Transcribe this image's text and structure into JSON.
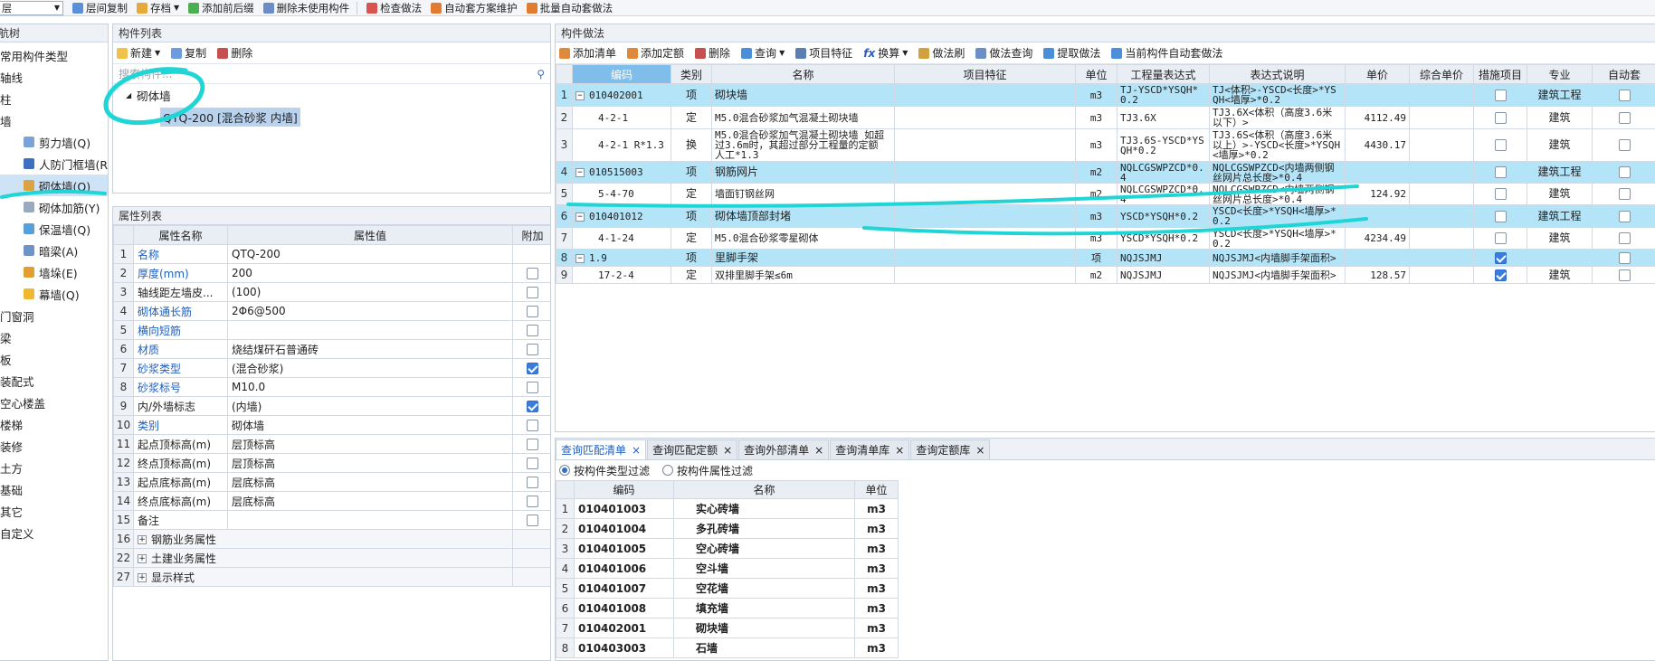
{
  "toolbar": {
    "floor_select": "层",
    "items": [
      "层间复制",
      "存档",
      "添加前后缀",
      "删除未使用构件",
      "检查做法",
      "自动套方案维护",
      "批量自动套做法"
    ]
  },
  "left_tree": {
    "title": "导航树",
    "items": [
      "常用构件类型",
      "轴线",
      "柱",
      "墙"
    ],
    "wall_children": [
      "剪力墙(Q)",
      "人防门框墙(R",
      "砌体墙(Q)",
      "砌体加筋(Y)",
      "保温墙(Q)",
      "暗梁(A)",
      "墙垛(E)",
      "幕墙(Q)"
    ],
    "after": [
      "门窗洞",
      "梁",
      "板",
      "装配式",
      "空心楼盖",
      "楼梯",
      "装修",
      "土方",
      "基础",
      "其它",
      "自定义"
    ]
  },
  "component_list": {
    "title": "构件列表",
    "buttons": [
      "新建",
      "复制",
      "删除"
    ],
    "search_placeholder": "搜索构件...",
    "group": "砌体墙",
    "selected": "QTQ-200 [混合砂浆 内墙]"
  },
  "property_list": {
    "title": "属性列表",
    "headers": [
      "属性名称",
      "属性值",
      "附加"
    ],
    "rows": [
      {
        "n": "1",
        "name": "名称",
        "value": "QTQ-200",
        "blue": true,
        "cb": "none"
      },
      {
        "n": "2",
        "name": "厚度(mm)",
        "value": "200",
        "blue": true,
        "cb": "off"
      },
      {
        "n": "3",
        "name": "轴线距左墙皮...",
        "value": "(100)",
        "blue": false,
        "cb": "off"
      },
      {
        "n": "4",
        "name": "砌体通长筋",
        "value": "2Φ6@500",
        "blue": true,
        "cb": "off"
      },
      {
        "n": "5",
        "name": "横向短筋",
        "value": "",
        "blue": true,
        "cb": "off"
      },
      {
        "n": "6",
        "name": "材质",
        "value": "烧结煤矸石普通砖",
        "blue": true,
        "cb": "off"
      },
      {
        "n": "7",
        "name": "砂浆类型",
        "value": "(混合砂浆)",
        "blue": true,
        "cb": "on"
      },
      {
        "n": "8",
        "name": "砂浆标号",
        "value": "M10.0",
        "blue": true,
        "cb": "off"
      },
      {
        "n": "9",
        "name": "内/外墙标志",
        "value": "(内墙)",
        "blue": false,
        "cb": "on"
      },
      {
        "n": "10",
        "name": "类别",
        "value": "砌体墙",
        "blue": true,
        "cb": "off"
      },
      {
        "n": "11",
        "name": "起点顶标高(m)",
        "value": "层顶标高",
        "blue": false,
        "cb": "off"
      },
      {
        "n": "12",
        "name": "终点顶标高(m)",
        "value": "层顶标高",
        "blue": false,
        "cb": "off"
      },
      {
        "n": "13",
        "name": "起点底标高(m)",
        "value": "层底标高",
        "blue": false,
        "cb": "off"
      },
      {
        "n": "14",
        "name": "终点底标高(m)",
        "value": "层底标高",
        "blue": false,
        "cb": "off"
      },
      {
        "n": "15",
        "name": "备注",
        "value": "",
        "blue": false,
        "cb": "off"
      }
    ],
    "groups": [
      {
        "n": "16",
        "name": "钢筋业务属性"
      },
      {
        "n": "22",
        "name": "土建业务属性"
      },
      {
        "n": "27",
        "name": "显示样式"
      }
    ]
  },
  "method": {
    "title": "构件做法",
    "buttons": [
      "添加清单",
      "添加定额",
      "删除",
      "查询",
      "项目特征",
      "换算",
      "做法刷",
      "做法查询",
      "提取做法",
      "当前构件自动套做法"
    ],
    "headers": [
      "编码",
      "类别",
      "名称",
      "项目特征",
      "单位",
      "工程量表达式",
      "表达式说明",
      "单价",
      "综合单价",
      "措施项目",
      "专业",
      "自动套"
    ],
    "rows": [
      {
        "n": "1",
        "hl": true,
        "expand": true,
        "code": "010402001",
        "type": "项",
        "name": "砌块墙",
        "feat": "",
        "unit": "m3",
        "expr": "TJ-YSCD*YSQH*0.2",
        "desc": "TJ<体积>-YSCD<长度>*YSQH<墙厚>*0.2",
        "price": "",
        "cb": false,
        "major": "建筑工程"
      },
      {
        "n": "2",
        "hl": false,
        "expand": false,
        "code": "4-2-1",
        "type": "定",
        "name": "M5.0混合砂浆加气混凝土砌块墙",
        "feat": "",
        "unit": "m3",
        "expr": "TJ3.6X",
        "desc": "TJ3.6X<体积（高度3.6米以下）>",
        "price": "4112.49",
        "cb": false,
        "major": "建筑"
      },
      {
        "n": "3",
        "hl": false,
        "expand": false,
        "code": "4-2-1 R*1.3",
        "type": "换",
        "name": "M5.0混合砂浆加气混凝土砌块墙 如超过3.6m时，其超过部分工程量的定额 人工*1.3",
        "feat": "",
        "unit": "m3",
        "expr": "TJ3.6S-YSCD*YSQH*0.2",
        "desc": "TJ3.6S<体积（高度3.6米以上）>-YSCD<长度>*YSQH<墙厚>*0.2",
        "price": "4430.17",
        "cb": false,
        "major": "建筑"
      },
      {
        "n": "4",
        "hl": true,
        "expand": true,
        "code": "010515003",
        "type": "项",
        "name": "钢筋网片",
        "feat": "",
        "unit": "m2",
        "expr": "NQLCGSWPZCD*0.4",
        "desc": "NQLCGSWPZCD<内墙两侧钢丝网片总长度>*0.4",
        "price": "",
        "cb": false,
        "major": "建筑工程"
      },
      {
        "n": "5",
        "hl": false,
        "expand": false,
        "code": "5-4-70",
        "type": "定",
        "name": "墙面钉钢丝网",
        "feat": "",
        "unit": "m2",
        "expr": "NQLCGSWPZCD*0.4",
        "desc": "NQLCGSWPZCD<内墙两侧钢丝网片总长度>*0.4",
        "price": "124.92",
        "cb": false,
        "major": "建筑"
      },
      {
        "n": "6",
        "hl": true,
        "expand": true,
        "code": "010401012",
        "type": "项",
        "name": "砌体墙顶部封堵",
        "feat": "",
        "unit": "m3",
        "expr": "YSCD*YSQH*0.2",
        "desc": "YSCD<长度>*YSQH<墙厚>*0.2",
        "price": "",
        "cb": false,
        "major": "建筑工程"
      },
      {
        "n": "7",
        "hl": false,
        "expand": false,
        "code": "4-1-24",
        "type": "定",
        "name": "M5.0混合砂浆零星砌体",
        "feat": "",
        "unit": "m3",
        "expr": "YSCD*YSQH*0.2",
        "desc": "YSCD<长度>*YSQH<墙厚>*0.2",
        "price": "4234.49",
        "cb": false,
        "major": "建筑"
      },
      {
        "n": "8",
        "hl": true,
        "expand": true,
        "code": "1.9",
        "type": "项",
        "name": "里脚手架",
        "feat": "",
        "unit": "项",
        "expr": "NQJSJMJ",
        "desc": "NQJSJMJ<内墙脚手架面积>",
        "price": "",
        "cb": true,
        "major": ""
      },
      {
        "n": "9",
        "hl": false,
        "expand": false,
        "code": "17-2-4",
        "type": "定",
        "name": "双排里脚手架≤6m",
        "feat": "",
        "unit": "m2",
        "expr": "NQJSJMJ",
        "desc": "NQJSJMJ<内墙脚手架面积>",
        "price": "128.57",
        "cb": true,
        "major": "建筑"
      }
    ]
  },
  "query": {
    "tabs": [
      "查询匹配清单",
      "查询匹配定额",
      "查询外部清单",
      "查询清单库",
      "查询定额库"
    ],
    "filters": [
      "按构件类型过滤",
      "按构件属性过滤"
    ],
    "headers": [
      "编码",
      "名称",
      "单位"
    ],
    "rows": [
      {
        "n": "1",
        "code": "010401003",
        "name": "实心砖墙",
        "unit": "m3"
      },
      {
        "n": "2",
        "code": "010401004",
        "name": "多孔砖墙",
        "unit": "m3"
      },
      {
        "n": "3",
        "code": "010401005",
        "name": "空心砖墙",
        "unit": "m3"
      },
      {
        "n": "4",
        "code": "010401006",
        "name": "空斗墙",
        "unit": "m3"
      },
      {
        "n": "5",
        "code": "010401007",
        "name": "空花墙",
        "unit": "m3"
      },
      {
        "n": "6",
        "code": "010401008",
        "name": "填充墙",
        "unit": "m3"
      },
      {
        "n": "7",
        "code": "010402001",
        "name": "砌块墙",
        "unit": "m3"
      },
      {
        "n": "8",
        "code": "010403003",
        "name": "石墙",
        "unit": "m3"
      }
    ]
  },
  "colors": {
    "annotation": "#1fd5d5",
    "highlight": "#b4e4f8",
    "accent": "#1f5fbf"
  }
}
